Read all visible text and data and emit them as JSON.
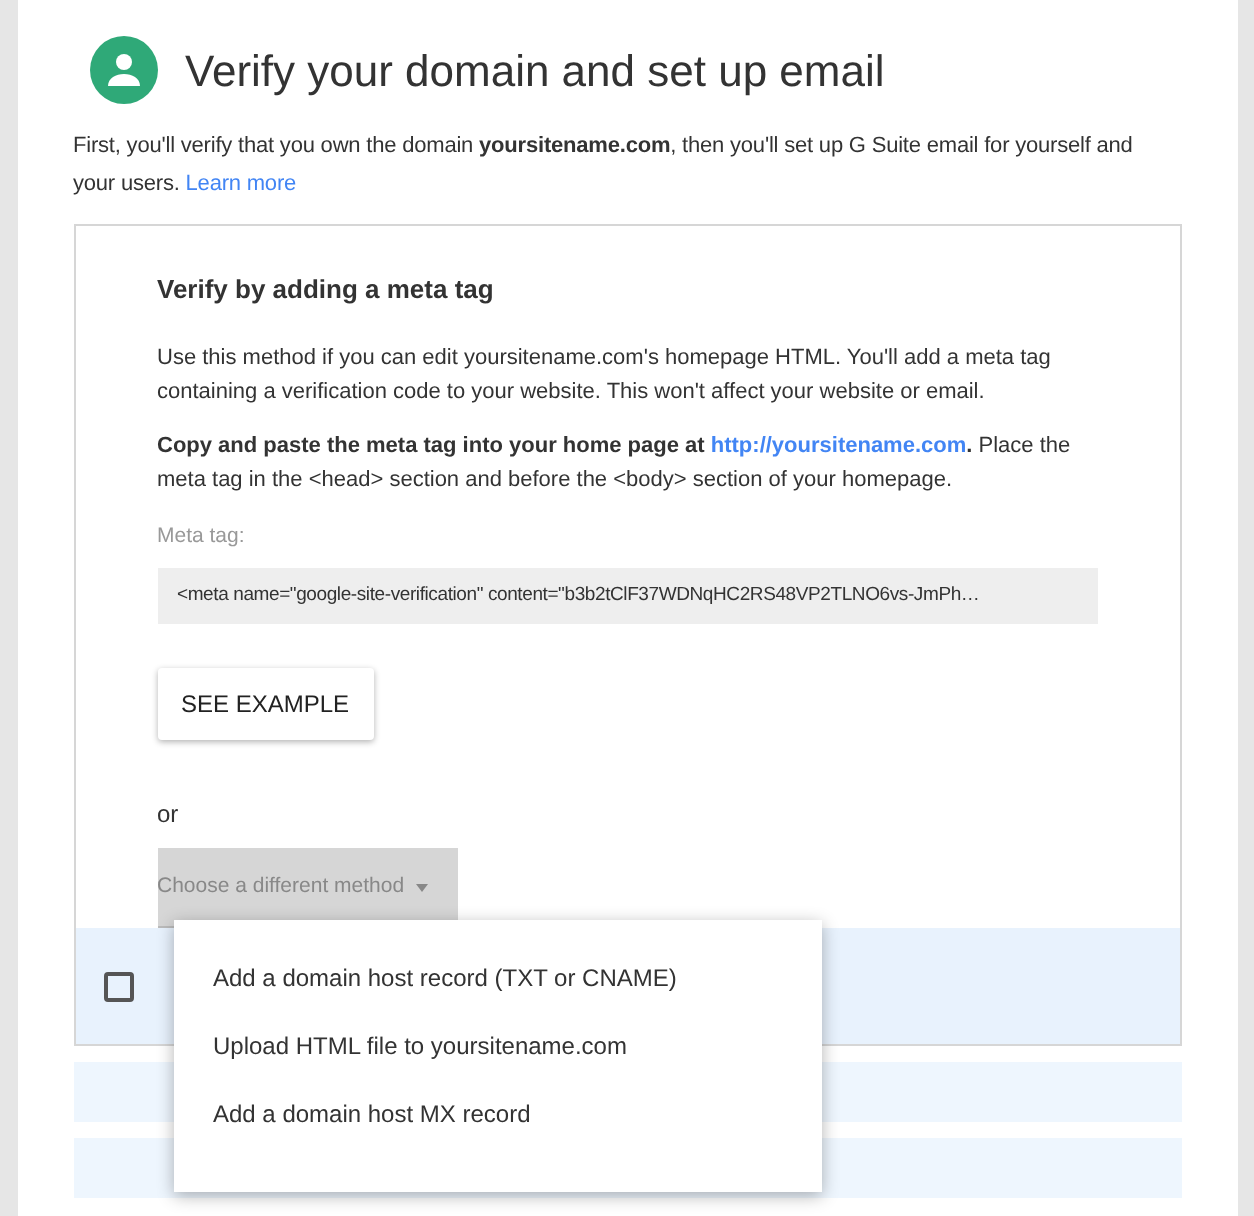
{
  "header": {
    "title": "Verify your domain and set up email",
    "intro": "First, you'll verify that you own the domain **yoursitename.com**, then you'll set up G Suite email for yourself and your users.",
    "learn_more": "Learn more"
  },
  "method": {
    "title": "Verify by adding a meta tag",
    "description": "Use this method if you can edit yoursitename.com's homepage HTML. You'll add a meta tag containing a verification code to your website. This won't affect your website or email.",
    "instruction_bold": "Copy and paste the meta tag into your home page at",
    "instruction_link": "http://yoursitename.com",
    "instruction_bold_end": ".",
    "instruction_rest": "Place the meta tag in the <head> section and before the <body> section of your homepage.",
    "meta_label": "Meta tag:",
    "meta_value": "<meta name=\"google-site-verification\" content=\"b3b2tClF37WDNqHC2RS48VP2TLNO6vs-JmPh…",
    "example_button": "SEE EXAMPLE",
    "or": "or"
  },
  "dropdown": {
    "placeholder": "Choose a different method",
    "expanded": true,
    "options": [
      "Add a domain host record (TXT or CNAME)",
      "Upload HTML file to yoursitename.com",
      "Add a domain host MX record"
    ]
  },
  "step": {
    "checked": false
  }
}
